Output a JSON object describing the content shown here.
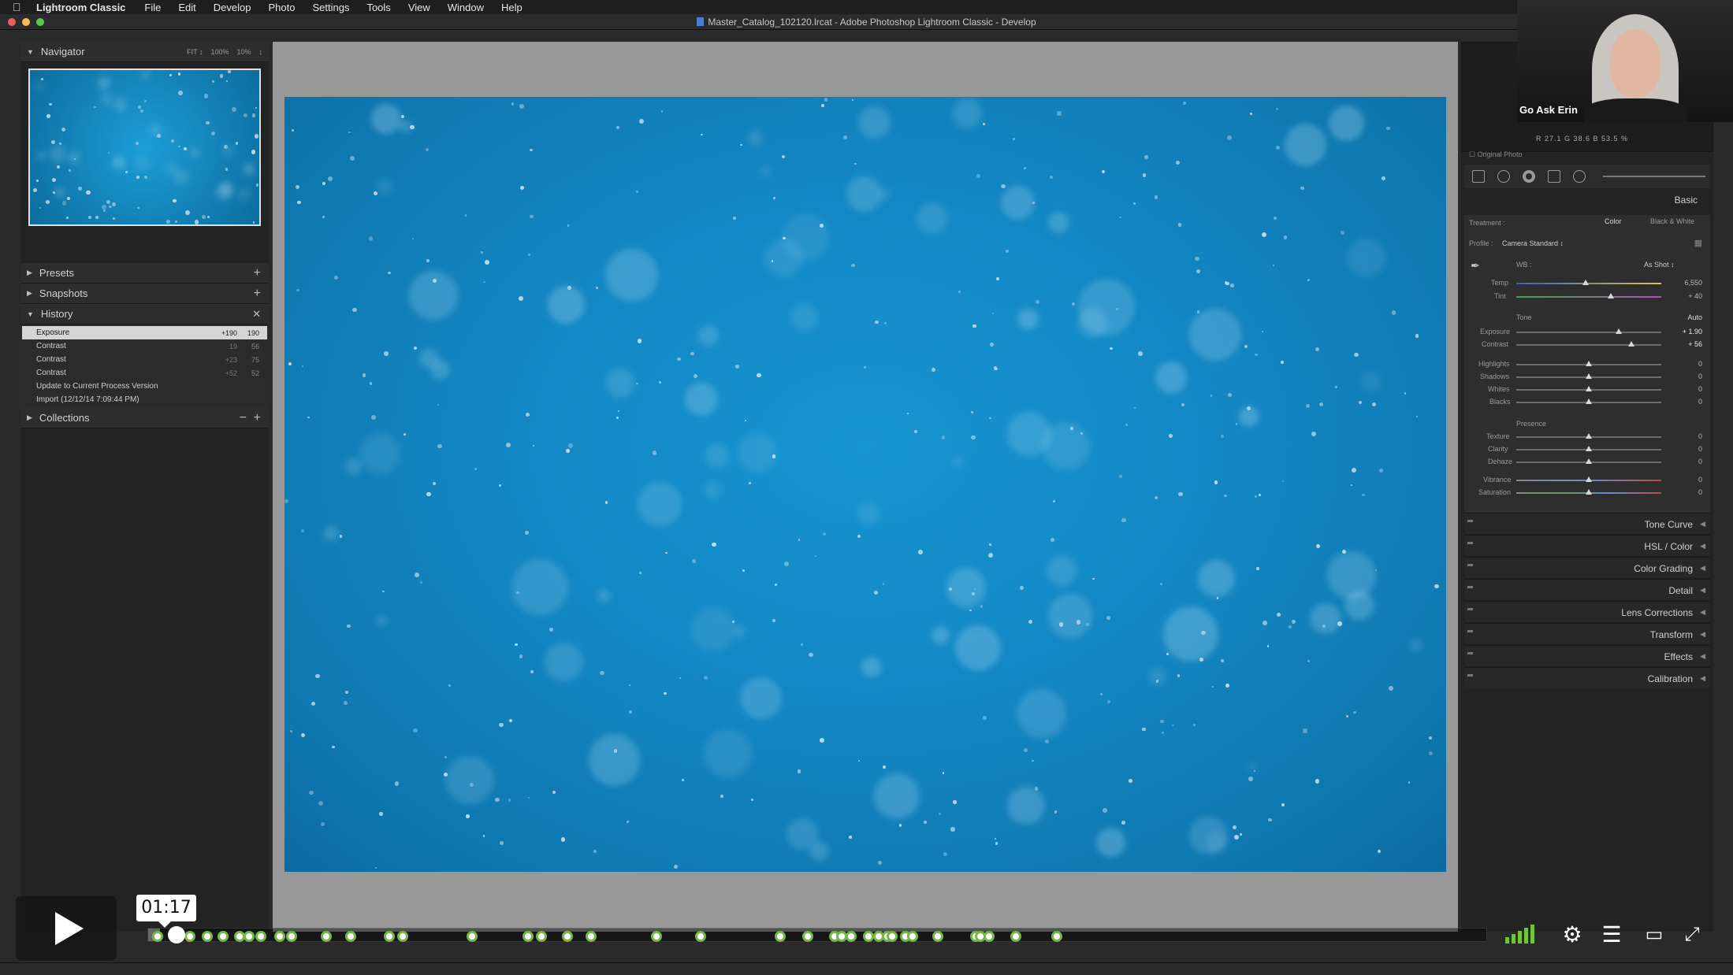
{
  "menubar": {
    "app_name": "Lightroom Classic",
    "items": [
      "File",
      "Edit",
      "Develop",
      "Photo",
      "Settings",
      "Tools",
      "View",
      "Window",
      "Help"
    ]
  },
  "window": {
    "title": "Master_Catalog_102120.lrcat - Adobe Photoshop Lightroom Classic - Develop"
  },
  "left_panel": {
    "navigator": {
      "title": "Navigator",
      "zoom_options": [
        "FIT ↕",
        "100%",
        "10%",
        "↕"
      ]
    },
    "presets_title": "Presets",
    "snapshots_title": "Snapshots",
    "history": {
      "title": "History",
      "items": [
        {
          "label": "Exposure",
          "v1": "+190",
          "v2": "190",
          "selected": true
        },
        {
          "label": "Contrast",
          "v1": "19",
          "v2": "56",
          "selected": false
        },
        {
          "label": "Contrast",
          "v1": "+23",
          "v2": "75",
          "selected": false
        },
        {
          "label": "Contrast",
          "v1": "+52",
          "v2": "52",
          "selected": false
        },
        {
          "label": "Update to Current Process Version",
          "v1": "",
          "v2": "",
          "selected": false
        },
        {
          "label": "Import (12/12/14 7:09:44 PM)",
          "v1": "",
          "v2": "",
          "selected": false
        }
      ]
    },
    "collections_title": "Collections"
  },
  "right_panel": {
    "rgb_readout": "R  27.1  G  38.6  B  53.5 %",
    "original_photo_label": "Original Photo",
    "basic": {
      "title": "Basic",
      "treatment_label": "Treatment :",
      "treatment_color": "Color",
      "treatment_bw": "Black & White",
      "profile_label": "Profile :",
      "profile_value": "Camera Standard ↕",
      "wb_label": "WB :",
      "wb_value": "As Shot ↕",
      "temp_label": "Temp",
      "temp_value": "6,550",
      "tint_label": "Tint",
      "tint_value": "+ 40",
      "tone_label": "Tone",
      "auto_label": "Auto",
      "exposure_label": "Exposure",
      "exposure_value": "+ 1.90",
      "contrast_label": "Contrast",
      "contrast_value": "+ 56",
      "highlights_label": "Highlights",
      "highlights_value": "0",
      "shadows_label": "Shadows",
      "shadows_value": "0",
      "whites_label": "Whites",
      "whites_value": "0",
      "blacks_label": "Blacks",
      "blacks_value": "0",
      "presence_label": "Presence",
      "texture_label": "Texture",
      "texture_value": "0",
      "clarity_label": "Clarity",
      "clarity_value": "0",
      "dehaze_label": "Dehaze",
      "dehaze_value": "0",
      "vibrance_label": "Vibrance",
      "vibrance_value": "0",
      "saturation_label": "Saturation",
      "saturation_value": "0"
    },
    "sections": [
      "Tone Curve",
      "HSL / Color",
      "Color Grading",
      "Detail",
      "Lens Corrections",
      "Transform",
      "Effects",
      "Calibration"
    ]
  },
  "webcam": {
    "name": "Go Ask Erin"
  },
  "player": {
    "timecode": "01:17",
    "progress": 0.009,
    "chapter_markers": [
      0.003,
      0.027,
      0.04,
      0.052,
      0.064,
      0.071,
      0.08,
      0.094,
      0.103,
      0.129,
      0.147,
      0.176,
      0.186,
      0.238,
      0.28,
      0.29,
      0.309,
      0.327,
      0.376,
      0.409,
      0.468,
      0.489,
      0.509,
      0.514,
      0.521,
      0.534,
      0.542,
      0.548,
      0.552,
      0.562,
      0.567,
      0.586,
      0.614,
      0.618,
      0.624,
      0.644,
      0.675
    ],
    "accent_color": "#74b84a"
  }
}
